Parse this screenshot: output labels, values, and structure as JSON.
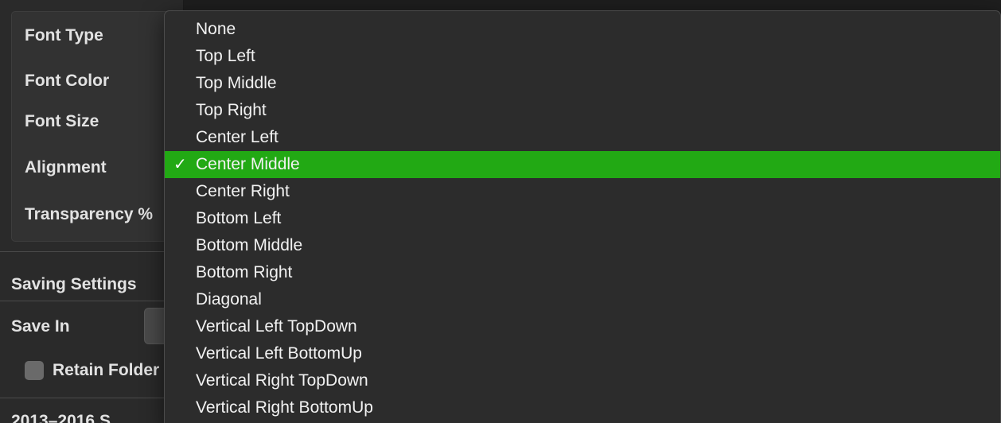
{
  "panel": {
    "text_settings": {
      "font_type_label": "Font Type",
      "font_color_label": "Font Color",
      "font_size_label": "Font Size",
      "alignment_label": "Alignment",
      "transparency_label": "Transparency %"
    },
    "saving_settings": {
      "section_title": "Saving Settings",
      "save_in_label": "Save In",
      "retain_folder_label": "Retain Folder Structure",
      "retain_folder_checked": false
    },
    "bottom_truncated_text": "2013–2016 S"
  },
  "alignment_menu": {
    "selected_index": 5,
    "check_glyph": "✓",
    "selected_color": "#22a914",
    "items": [
      "None",
      "Top Left",
      "Top Middle",
      "Top Right",
      "Center Left",
      "Center Middle",
      "Center Right",
      "Bottom Left",
      "Bottom Middle",
      "Bottom Right",
      "Diagonal",
      "Vertical Left TopDown",
      "Vertical Left BottomUp",
      "Vertical Right TopDown",
      "Vertical Right BottomUp"
    ]
  }
}
